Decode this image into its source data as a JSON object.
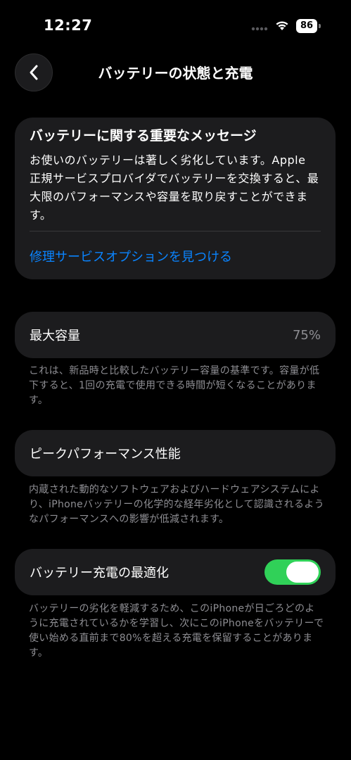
{
  "status_bar": {
    "time": "12:27",
    "battery_level": "86",
    "icons": [
      "signal-dots-icon",
      "wifi-icon",
      "battery-icon"
    ]
  },
  "nav": {
    "back_icon": "chevron-left-icon",
    "title": "バッテリーの状態と充電"
  },
  "message_card": {
    "title": "バッテリーに関する重要なメッセージ",
    "body": "お使いのバッテリーは著しく劣化しています。Apple 正規サービスプロバイダでバッテリーを交換すると、最大限のパフォーマンスや容量を取り戻すことができます。",
    "link": "修理サービスオプションを見つける"
  },
  "max_capacity": {
    "label": "最大容量",
    "value": "75%",
    "footnote": "これは、新品時と比較したバッテリー容量の基準です。容量が低下すると、1回の充電で使用できる時間が短くなることがあります。"
  },
  "peak_performance": {
    "label": "ピークパフォーマンス性能",
    "footnote": "内蔵された動的なソフトウェアおよびハードウェアシステムにより、iPhoneバッテリーの化学的な経年劣化として認識されるようなパフォーマンスへの影響が低減されます。"
  },
  "optimized_charging": {
    "label": "バッテリー充電の最適化",
    "enabled": true,
    "footnote": "バッテリーの劣化を軽減するため、このiPhoneが日ごろどのように充電されているかを学習し、次にこのiPhoneをバッテリーで使い始める直前まで80%を超える充電を保留することがあります。"
  },
  "colors": {
    "background": "#000000",
    "card": "#1c1c1e",
    "link": "#0a84ff",
    "toggle_on": "#30d158",
    "secondary_text": "#8e8e93"
  }
}
